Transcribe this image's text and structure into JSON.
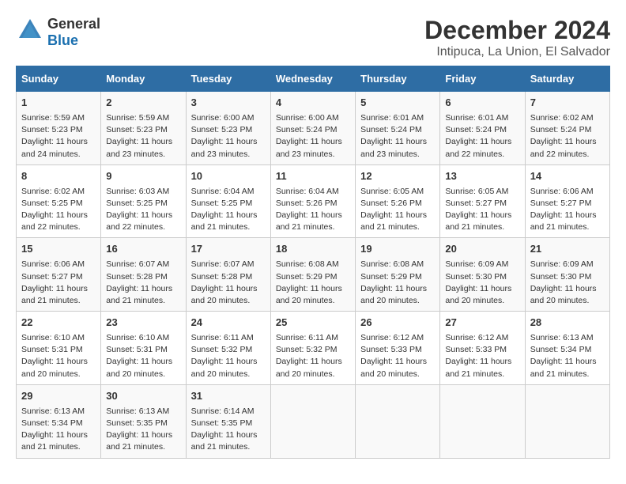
{
  "logo": {
    "general": "General",
    "blue": "Blue"
  },
  "title": "December 2024",
  "subtitle": "Intipuca, La Union, El Salvador",
  "days_header": [
    "Sunday",
    "Monday",
    "Tuesday",
    "Wednesday",
    "Thursday",
    "Friday",
    "Saturday"
  ],
  "weeks": [
    [
      {
        "day": "1",
        "info": "Sunrise: 5:59 AM\nSunset: 5:23 PM\nDaylight: 11 hours\nand 24 minutes."
      },
      {
        "day": "2",
        "info": "Sunrise: 5:59 AM\nSunset: 5:23 PM\nDaylight: 11 hours\nand 23 minutes."
      },
      {
        "day": "3",
        "info": "Sunrise: 6:00 AM\nSunset: 5:23 PM\nDaylight: 11 hours\nand 23 minutes."
      },
      {
        "day": "4",
        "info": "Sunrise: 6:00 AM\nSunset: 5:24 PM\nDaylight: 11 hours\nand 23 minutes."
      },
      {
        "day": "5",
        "info": "Sunrise: 6:01 AM\nSunset: 5:24 PM\nDaylight: 11 hours\nand 23 minutes."
      },
      {
        "day": "6",
        "info": "Sunrise: 6:01 AM\nSunset: 5:24 PM\nDaylight: 11 hours\nand 22 minutes."
      },
      {
        "day": "7",
        "info": "Sunrise: 6:02 AM\nSunset: 5:24 PM\nDaylight: 11 hours\nand 22 minutes."
      }
    ],
    [
      {
        "day": "8",
        "info": "Sunrise: 6:02 AM\nSunset: 5:25 PM\nDaylight: 11 hours\nand 22 minutes."
      },
      {
        "day": "9",
        "info": "Sunrise: 6:03 AM\nSunset: 5:25 PM\nDaylight: 11 hours\nand 22 minutes."
      },
      {
        "day": "10",
        "info": "Sunrise: 6:04 AM\nSunset: 5:25 PM\nDaylight: 11 hours\nand 21 minutes."
      },
      {
        "day": "11",
        "info": "Sunrise: 6:04 AM\nSunset: 5:26 PM\nDaylight: 11 hours\nand 21 minutes."
      },
      {
        "day": "12",
        "info": "Sunrise: 6:05 AM\nSunset: 5:26 PM\nDaylight: 11 hours\nand 21 minutes."
      },
      {
        "day": "13",
        "info": "Sunrise: 6:05 AM\nSunset: 5:27 PM\nDaylight: 11 hours\nand 21 minutes."
      },
      {
        "day": "14",
        "info": "Sunrise: 6:06 AM\nSunset: 5:27 PM\nDaylight: 11 hours\nand 21 minutes."
      }
    ],
    [
      {
        "day": "15",
        "info": "Sunrise: 6:06 AM\nSunset: 5:27 PM\nDaylight: 11 hours\nand 21 minutes."
      },
      {
        "day": "16",
        "info": "Sunrise: 6:07 AM\nSunset: 5:28 PM\nDaylight: 11 hours\nand 21 minutes."
      },
      {
        "day": "17",
        "info": "Sunrise: 6:07 AM\nSunset: 5:28 PM\nDaylight: 11 hours\nand 20 minutes."
      },
      {
        "day": "18",
        "info": "Sunrise: 6:08 AM\nSunset: 5:29 PM\nDaylight: 11 hours\nand 20 minutes."
      },
      {
        "day": "19",
        "info": "Sunrise: 6:08 AM\nSunset: 5:29 PM\nDaylight: 11 hours\nand 20 minutes."
      },
      {
        "day": "20",
        "info": "Sunrise: 6:09 AM\nSunset: 5:30 PM\nDaylight: 11 hours\nand 20 minutes."
      },
      {
        "day": "21",
        "info": "Sunrise: 6:09 AM\nSunset: 5:30 PM\nDaylight: 11 hours\nand 20 minutes."
      }
    ],
    [
      {
        "day": "22",
        "info": "Sunrise: 6:10 AM\nSunset: 5:31 PM\nDaylight: 11 hours\nand 20 minutes."
      },
      {
        "day": "23",
        "info": "Sunrise: 6:10 AM\nSunset: 5:31 PM\nDaylight: 11 hours\nand 20 minutes."
      },
      {
        "day": "24",
        "info": "Sunrise: 6:11 AM\nSunset: 5:32 PM\nDaylight: 11 hours\nand 20 minutes."
      },
      {
        "day": "25",
        "info": "Sunrise: 6:11 AM\nSunset: 5:32 PM\nDaylight: 11 hours\nand 20 minutes."
      },
      {
        "day": "26",
        "info": "Sunrise: 6:12 AM\nSunset: 5:33 PM\nDaylight: 11 hours\nand 20 minutes."
      },
      {
        "day": "27",
        "info": "Sunrise: 6:12 AM\nSunset: 5:33 PM\nDaylight: 11 hours\nand 21 minutes."
      },
      {
        "day": "28",
        "info": "Sunrise: 6:13 AM\nSunset: 5:34 PM\nDaylight: 11 hours\nand 21 minutes."
      }
    ],
    [
      {
        "day": "29",
        "info": "Sunrise: 6:13 AM\nSunset: 5:34 PM\nDaylight: 11 hours\nand 21 minutes."
      },
      {
        "day": "30",
        "info": "Sunrise: 6:13 AM\nSunset: 5:35 PM\nDaylight: 11 hours\nand 21 minutes."
      },
      {
        "day": "31",
        "info": "Sunrise: 6:14 AM\nSunset: 5:35 PM\nDaylight: 11 hours\nand 21 minutes."
      },
      {
        "day": "",
        "info": ""
      },
      {
        "day": "",
        "info": ""
      },
      {
        "day": "",
        "info": ""
      },
      {
        "day": "",
        "info": ""
      }
    ]
  ]
}
